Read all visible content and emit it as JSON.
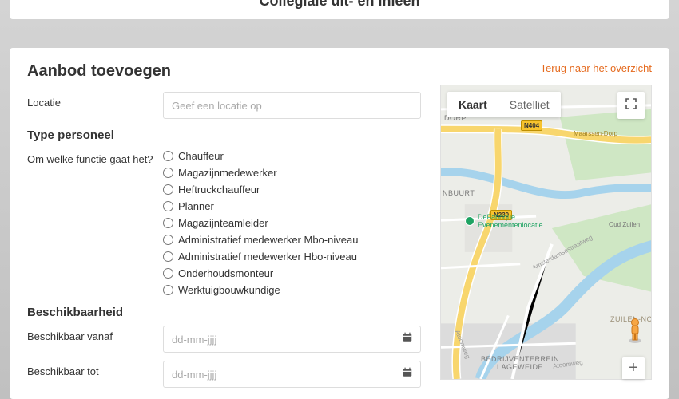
{
  "banner": {
    "title": "Collegiale uit- en inleen"
  },
  "page": {
    "title": "Aanbod toevoegen",
    "back_link": "Terug naar het overzicht"
  },
  "form": {
    "locatie": {
      "label": "Locatie",
      "placeholder": "Geef een locatie op",
      "value": ""
    },
    "type_personeel": {
      "heading": "Type personeel",
      "question": "Om welke functie gaat het?",
      "options": [
        "Chauffeur",
        "Magazijnmedewerker",
        "Heftruckchauffeur",
        "Planner",
        "Magazijnteamleider",
        "Administratief medewerker Mbo-niveau",
        "Administratief medewerker Hbo-niveau",
        "Onderhoudsmonteur",
        "Werktuigbouwkundige"
      ]
    },
    "beschikbaarheid": {
      "heading": "Beschikbaarheid",
      "vanaf": {
        "label": "Beschikbaar vanaf",
        "placeholder": "dd-mm-jjjj",
        "value": ""
      },
      "tot": {
        "label": "Beschikbaar tot",
        "placeholder": "dd-mm-jjjj",
        "value": ""
      }
    }
  },
  "map": {
    "type_kaart": "Kaart",
    "type_satelliet": "Satelliet",
    "roads": {
      "n404": "N404",
      "n230": "N230"
    },
    "labels": {
      "dorp": "DORP",
      "maarssen": "Maarssen-Dorp",
      "nbuurt": "NBUURT",
      "oudzuilen": "Oud Zuilen",
      "zuilen": "ZUILEN-NO",
      "lageweide": "BEDRIJVENTERREIN\nLAGEWEIDE",
      "amsterdamse": "Amsterdamsestraatweg",
      "atoomweg1": "Atoomweg",
      "atoomweg2": "Atoomweg"
    },
    "poi": {
      "defabrique": "DeFabrique\nEvenementenlocatie"
    },
    "zoom_plus": "+"
  }
}
